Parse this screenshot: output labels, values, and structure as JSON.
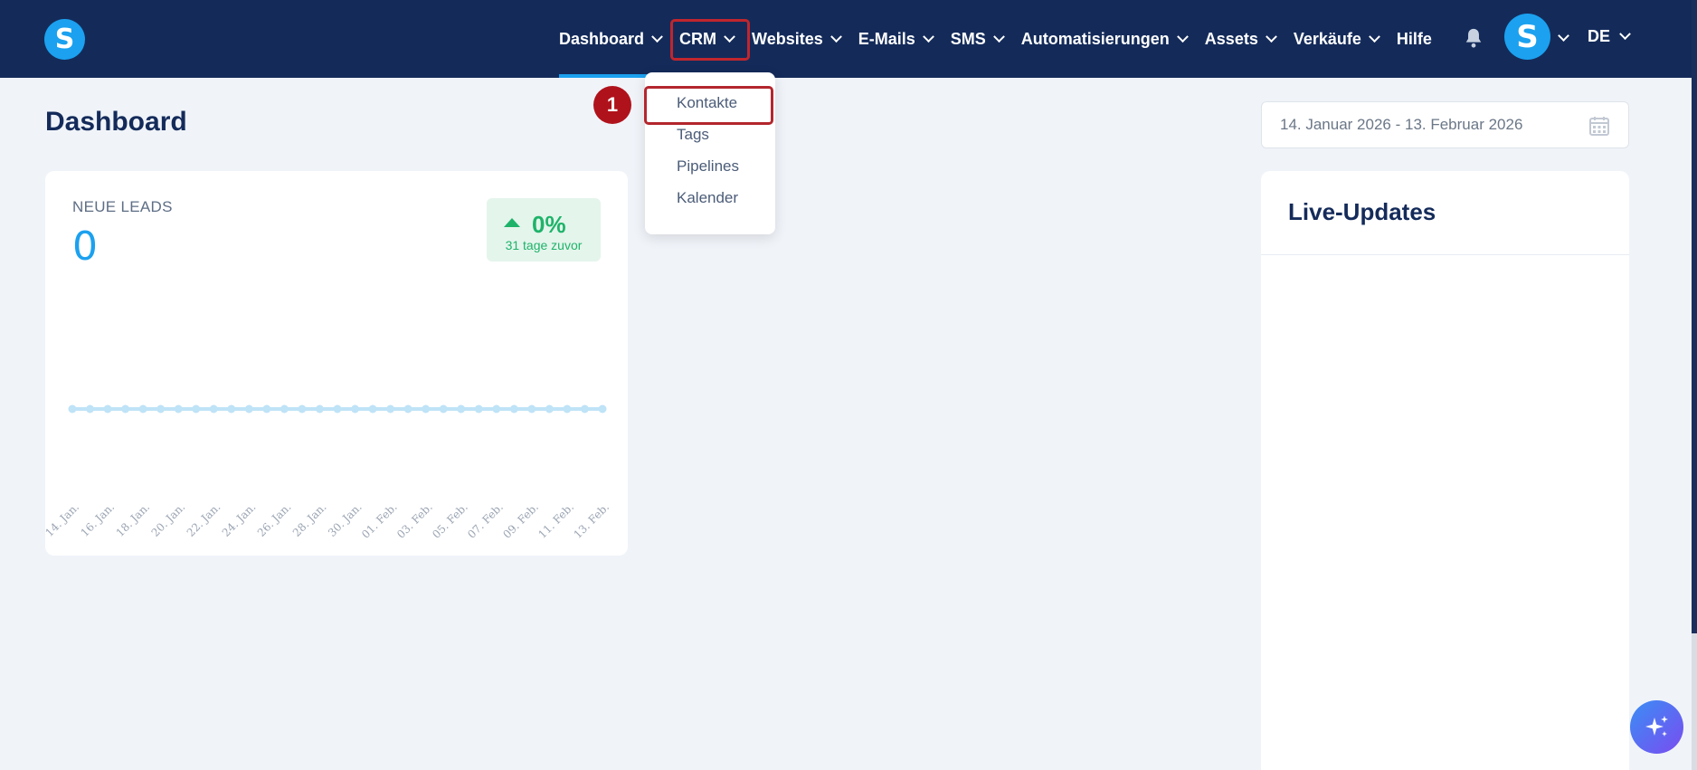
{
  "nav": {
    "logo_letter": "S",
    "items": [
      {
        "label": "Dashboard",
        "has_dropdown": true,
        "active": true
      },
      {
        "label": "CRM",
        "has_dropdown": true,
        "active": false
      },
      {
        "label": "Websites",
        "has_dropdown": true,
        "active": false
      },
      {
        "label": "E-Mails",
        "has_dropdown": true,
        "active": false
      },
      {
        "label": "SMS",
        "has_dropdown": true,
        "active": false
      },
      {
        "label": "Automatisierungen",
        "has_dropdown": true,
        "active": false
      },
      {
        "label": "Assets",
        "has_dropdown": true,
        "active": false
      },
      {
        "label": "Verkäufe",
        "has_dropdown": true,
        "active": false
      },
      {
        "label": "Hilfe",
        "has_dropdown": false,
        "active": false
      }
    ],
    "avatar_letter": "S",
    "language": "DE",
    "icons": [
      "bell-icon",
      "chevron-down-icon"
    ]
  },
  "crm_dropdown": {
    "items": [
      "Kontakte",
      "Tags",
      "Pipelines",
      "Kalender"
    ]
  },
  "annotation": {
    "step": "1"
  },
  "page": {
    "title": "Dashboard"
  },
  "date_range": {
    "value": "14. Januar 2026 - 13. Februar 2026",
    "icon": "calendar-icon"
  },
  "leads": {
    "label": "NEUE LEADS",
    "value": "0",
    "growth_value": "0%",
    "growth_caption": "31 tage zuvor"
  },
  "chart_data": {
    "type": "line",
    "categories": [
      "14. Jan.",
      "16. Jan.",
      "18. Jan.",
      "20. Jan.",
      "22. Jan.",
      "24. Jan.",
      "26. Jan.",
      "28. Jan.",
      "30. Jan.",
      "01. Feb.",
      "03. Feb.",
      "05. Feb.",
      "07. Feb.",
      "09. Feb.",
      "11. Feb.",
      "13. Feb."
    ],
    "point_count": 31,
    "values": [
      0,
      0,
      0,
      0,
      0,
      0,
      0,
      0,
      0,
      0,
      0,
      0,
      0,
      0,
      0,
      0,
      0,
      0,
      0,
      0,
      0,
      0,
      0,
      0,
      0,
      0,
      0,
      0,
      0,
      0,
      0
    ],
    "color": "#bfe3f7"
  },
  "live": {
    "title": "Live-Updates"
  },
  "colors": {
    "nav_bg": "#142b5a",
    "accent": "#1ba1ef",
    "success": "#1fb36a",
    "annotation": "#b0121b"
  }
}
